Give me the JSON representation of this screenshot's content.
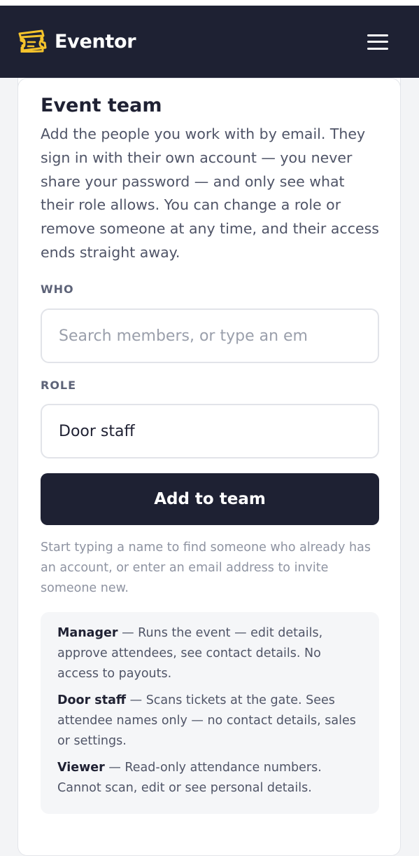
{
  "app": {
    "brand_name": "Eventor",
    "brand_color": "#f5c32c",
    "nav_bg": "#1e2133",
    "logo_icon": "ticket-icon",
    "menu_icon": "hamburger-menu-icon"
  },
  "section": {
    "title": "Event team",
    "intro": "Add the people you work with by email. They sign in with their own account — you never share your password — and only see what their role allows. You can change a role or remove someone at any time, and their access ends straight away."
  },
  "form": {
    "who_label": "WHO",
    "who_placeholder": "Search members, or type an em",
    "who_value": "",
    "role_label": "ROLE",
    "role_value": "Door staff",
    "submit_label": "Add to team",
    "hint": "Start typing a name to find someone who already has an account, or enter an email address to invite someone new."
  },
  "roles": [
    {
      "name": "Manager",
      "description": " — Runs the event — edit details, approve attendees, see contact details. No access to payouts."
    },
    {
      "name": "Door staff",
      "description": " — Scans tickets at the gate. Sees attendee names only — no contact details, sales or settings."
    },
    {
      "name": "Viewer",
      "description": " — Read-only attendance numbers. Cannot scan, edit or see personal details."
    }
  ]
}
